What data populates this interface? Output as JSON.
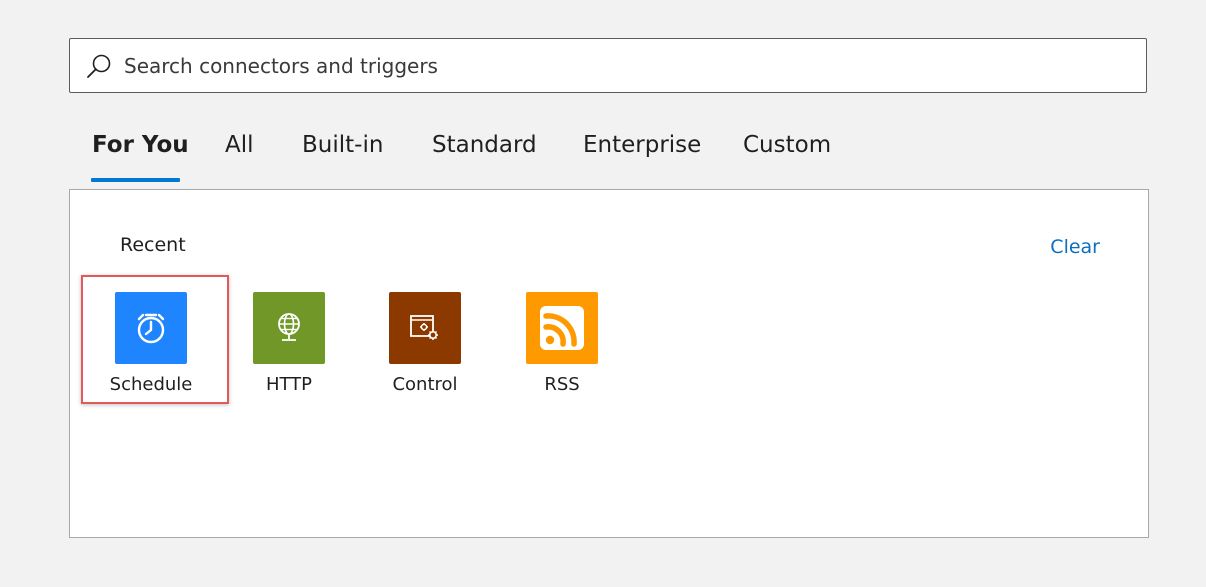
{
  "search": {
    "placeholder": "Search connectors and triggers",
    "value": ""
  },
  "tabs": [
    {
      "label": "For You",
      "active": true
    },
    {
      "label": "All",
      "active": false
    },
    {
      "label": "Built-in",
      "active": false
    },
    {
      "label": "Standard",
      "active": false
    },
    {
      "label": "Enterprise",
      "active": false
    },
    {
      "label": "Custom",
      "active": false
    }
  ],
  "recent": {
    "heading": "Recent",
    "clear_label": "Clear",
    "connectors": [
      {
        "label": "Schedule",
        "icon": "alarm-clock-icon",
        "color": "#1f85ff",
        "selected": true
      },
      {
        "label": "HTTP",
        "icon": "globe-icon",
        "color": "#709727",
        "selected": false
      },
      {
        "label": "Control",
        "icon": "window-gears-icon",
        "color": "#8c3900",
        "selected": false
      },
      {
        "label": "RSS",
        "icon": "rss-feed-icon",
        "color": "#ff9900",
        "selected": false
      }
    ]
  },
  "colors": {
    "accent": "#0078d4",
    "link": "#106ebe",
    "highlight": "#e05a5a",
    "background": "#f2f2f2"
  }
}
